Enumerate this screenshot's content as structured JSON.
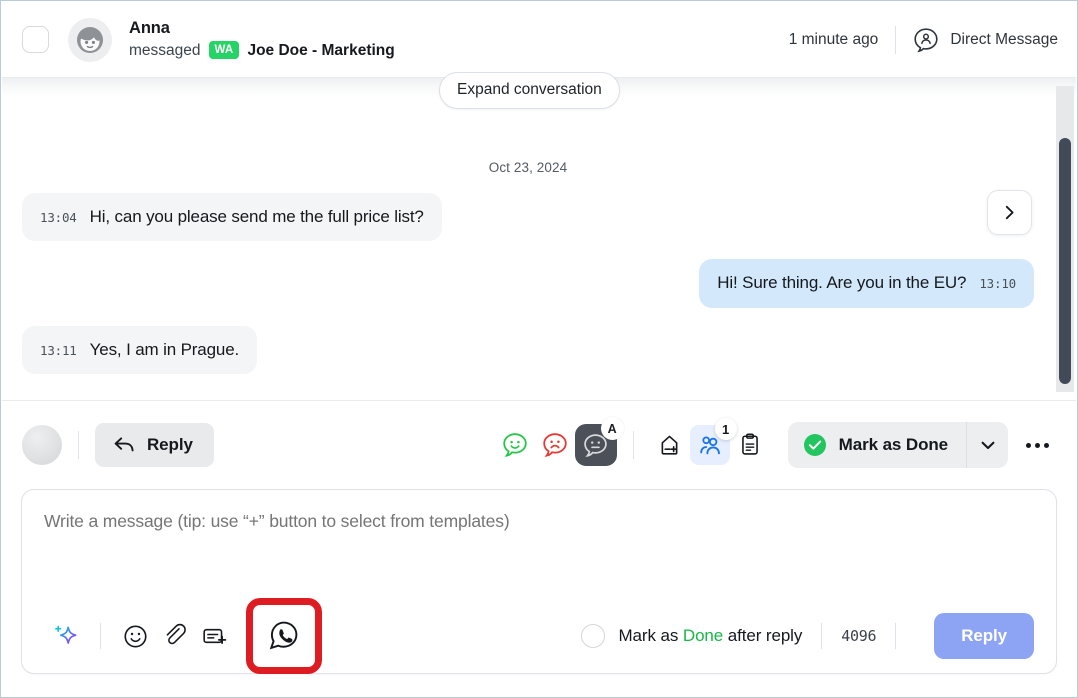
{
  "header": {
    "sender_name": "Anna",
    "action_verb": "messaged",
    "channel_badge": "WA",
    "contact_name": "Joe Doe - Marketing",
    "timestamp": "1 minute ago",
    "conversation_type": "Direct Message",
    "avatar_icon": "person-avatar-icon",
    "dm_icon": "person-chat-bubble-icon",
    "select_checkbox_name": "select-conversation-checkbox"
  },
  "conversation": {
    "expand_label": "Expand conversation",
    "date_separator": "Oct 23, 2024",
    "scroll_next_icon": "chevron-right-icon",
    "messages": [
      {
        "time": "13:04",
        "text": "Hi, can you please send me the full price list?",
        "direction": "in"
      },
      {
        "time": "13:10",
        "text": "Hi! Sure thing. Are you in the EU?",
        "direction": "out"
      },
      {
        "time": "13:11",
        "text": "Yes, I am in Prague.",
        "direction": "in"
      }
    ]
  },
  "toolbar": {
    "reply_label": "Reply",
    "reply_icon": "reply-arrow-icon",
    "avatar_icon": "agent-avatar-icon",
    "sentiment_positive_icon": "happy-chat-icon",
    "sentiment_negative_icon": "sad-chat-icon",
    "sentiment_neutral_icon": "neutral-chat-icon",
    "sentiment_neutral_badge": "A",
    "tag_icon": "add-tag-icon",
    "assignees_icon": "assign-people-icon",
    "assignees_badge": "1",
    "notes_icon": "clipboard-notes-icon",
    "done_label": "Mark as Done",
    "done_check_icon": "green-check-circle-icon",
    "done_caret_icon": "chevron-down-icon",
    "more_icon": "more-options-icon",
    "colors": {
      "positive": "#29c54a",
      "negative": "#e53935",
      "neutral_bg": "#4b5059",
      "assignees_accent": "#1a73e8",
      "done_green": "#22c55e"
    }
  },
  "composer": {
    "placeholder": "Write a message (tip: use “+” button to select from templates)",
    "value": "",
    "ai_icon": "ai-sparkle-icon",
    "emoji_icon": "emoji-smiley-icon",
    "attach_icon": "paperclip-icon",
    "template_icon": "add-template-icon",
    "channel_icon": "whatsapp-icon",
    "channel_icon_highlighted": true,
    "highlight_color": "#dd1d21",
    "mark_done_prefix": "Mark as",
    "mark_done_green": "Done",
    "mark_done_suffix": "after reply",
    "char_count": "4096",
    "submit_label": "Reply",
    "submit_color": "#8da4f5"
  }
}
